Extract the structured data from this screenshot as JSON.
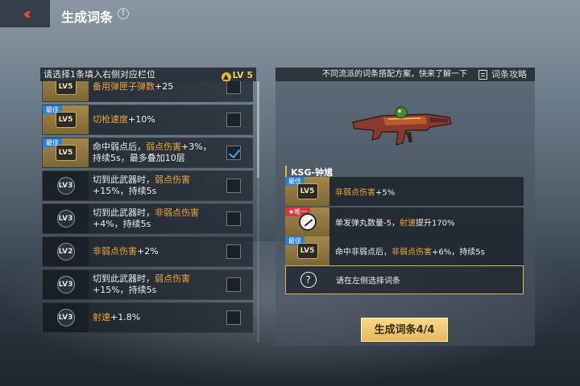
{
  "header": {
    "back_icon": "double-chevron-left-icon",
    "title": "生成词条",
    "info_icon": "exclamation-info-icon"
  },
  "left": {
    "instruction": "请选择1条填入右侧对应栏位",
    "level_label": "LV 5",
    "level_icon": "up-arrow-icon",
    "items": [
      {
        "best": "最佳",
        "level": "LV5",
        "gold": true,
        "parts": [
          [
            "备用弹匣子弹数",
            "hl"
          ],
          [
            "+25",
            ""
          ]
        ],
        "checked": false
      },
      {
        "best": "最佳",
        "level": "LV5",
        "gold": true,
        "parts": [
          [
            "切枪速度",
            "hl"
          ],
          [
            "+10%",
            ""
          ]
        ],
        "checked": false
      },
      {
        "best": "最佳",
        "level": "LV5",
        "gold": true,
        "parts": [
          [
            "命中弱点后，",
            ""
          ],
          [
            "弱点伤害",
            "hl"
          ],
          [
            "+3%，持续5s，最多叠加10层",
            ""
          ]
        ],
        "checked": true
      },
      {
        "best": "",
        "level": "LV3",
        "gold": false,
        "parts": [
          [
            "切到此武器时，",
            ""
          ],
          [
            "弱点伤害",
            "hl"
          ],
          [
            "+15%，持续5s",
            ""
          ]
        ],
        "checked": false
      },
      {
        "best": "",
        "level": "LV3",
        "gold": false,
        "parts": [
          [
            "切到此武器时，",
            ""
          ],
          [
            "非弱点伤害",
            "hl"
          ],
          [
            "+4%，持续5s",
            ""
          ]
        ],
        "checked": false
      },
      {
        "best": "",
        "level": "LV2",
        "gold": false,
        "parts": [
          [
            "非弱点伤害",
            "hl"
          ],
          [
            "+2%",
            ""
          ]
        ],
        "checked": false
      },
      {
        "best": "",
        "level": "LV3",
        "gold": false,
        "parts": [
          [
            "切到此武器时，",
            ""
          ],
          [
            "弱点伤害",
            "hl"
          ],
          [
            "+15%，持续5s",
            ""
          ]
        ],
        "checked": false
      },
      {
        "best": "",
        "level": "LV3",
        "gold": false,
        "parts": [
          [
            "射速",
            "hl"
          ],
          [
            "+1.8%",
            ""
          ]
        ],
        "checked": false
      }
    ]
  },
  "right": {
    "tip": "不同流派的词条搭配方案，快来了解一下",
    "guide_label": "词条攻略",
    "guide_icon": "document-icon",
    "weapon_name": "KSG-钟馗",
    "slots": [
      {
        "tag": "最佳",
        "tag_type": "best",
        "level": "LV5",
        "parts": [
          [
            "非弱点伤害",
            "hl"
          ],
          [
            "+5%",
            ""
          ]
        ]
      },
      {
        "tag": "★唯一",
        "tag_type": "unique",
        "icon": "knife-icon",
        "parts": [
          [
            "单发弹丸数量-5，",
            ""
          ],
          [
            "射速",
            "hl"
          ],
          [
            "提升170%",
            ""
          ]
        ]
      },
      {
        "tag": "最佳",
        "tag_type": "best",
        "level": "LV5",
        "parts": [
          [
            "命中非弱点后，",
            ""
          ],
          [
            "非弱点伤害",
            "hl"
          ],
          [
            "+6%，持续5s",
            ""
          ]
        ]
      }
    ],
    "empty_slot": {
      "icon": "question-mark-icon",
      "text": "请在左侧选择词条"
    },
    "generate_button": "生成词条4/4"
  },
  "colors": {
    "highlight": "#f0a33a",
    "gold": "#e6b85a",
    "check": "#4aa6ef",
    "back": "#f04a3a"
  }
}
